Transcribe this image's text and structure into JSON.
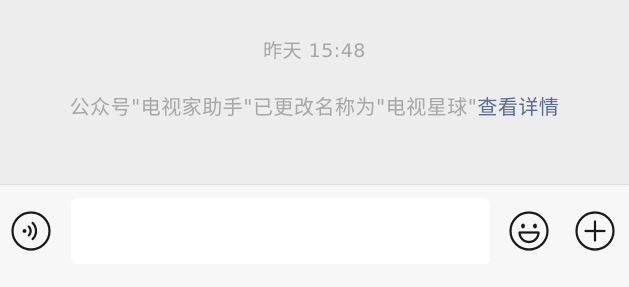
{
  "chat": {
    "timestamp": "昨天 15:48",
    "notice_text": "公众号\"电视家助手\"已更改名称为\"电视星球\"",
    "notice_link": "查看详情"
  },
  "input_bar": {
    "text_value": "",
    "voice_icon": "voice-wave-icon",
    "emoji_icon": "smiley-face-icon",
    "plus_icon": "plus-circle-icon"
  },
  "colors": {
    "chat_background": "#ededed",
    "input_bar_background": "#f7f7f7",
    "system_text": "#a7a7a7",
    "link": "#576b95",
    "icon_stroke": "#181818"
  }
}
